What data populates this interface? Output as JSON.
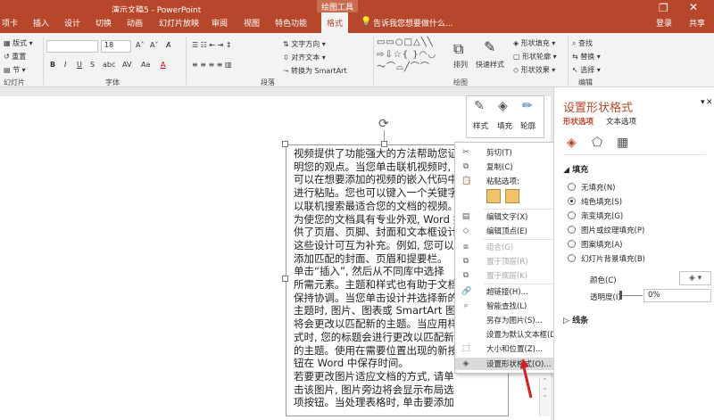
{
  "title": {
    "doc": "演示文稿5 - PowerPoint",
    "tools": "绘图工具"
  },
  "tabs": [
    "项卡",
    "插入",
    "设计",
    "切换",
    "动画",
    "幻灯片放映",
    "审阅",
    "视图",
    "特色功能",
    "格式"
  ],
  "tellme": "告诉我您想要做什么...",
  "user": {
    "login": "登录",
    "share": "共享"
  },
  "ribbon": {
    "layout": "版式",
    "reset": "重置",
    "section": "节",
    "slides_group": "幻灯片",
    "font_group": "字体",
    "para_group": "段落",
    "draw_group": "绘图",
    "edit_group": "编辑",
    "font_size": "18",
    "text_direction": "文字方向",
    "align_text": "对齐文本",
    "smartart": "转换为 SmartArt",
    "arrange": "排列",
    "quick_styles": "快速样式",
    "shape_fill": "形状填充",
    "shape_outline": "形状轮廓",
    "shape_effects": "形状效果",
    "find": "查找",
    "replace": "替换",
    "select": "选择"
  },
  "mini_toolbar": [
    "样式",
    "填充",
    "轮廓"
  ],
  "slide_text": [
    "视频提供了功能强大的方法帮助您证",
    "明您的观点。当您单击联机视频时,",
    "可以在想要添加的视频的嵌入代码中",
    "进行粘贴。您也可以键入一个关键字",
    "以联机搜索最适合您的文档的视频。",
    "为使您的文档具有专业外观, Word 提",
    "供了页眉、页脚、封面和文本框设计,",
    "这些设计可互为补充。例如, 您可以",
    "添加匹配的封面、页眉和提要栏。",
    "单击“插入”, 然后从不同库中选择",
    "所需元素。主题和样式也有助于文档",
    "保持协调。当您单击设计并选择新的",
    "主题时, 图片、图表或 SmartArt 图形",
    "将会更改以匹配新的主题。当应用样",
    "式时, 您的标题会进行更改以匹配新",
    "的主题。使用在需要位置出现的新按",
    "钮在 Word 中保存时间。",
    "若要更改图片适应文档的方式, 请单",
    "击该图片, 图片旁边将会显示布局选",
    "项按钮。当处理表格时, 单击要添加"
  ],
  "context_menu": {
    "cut": "剪切(T)",
    "copy": "复制(C)",
    "paste_options": "粘贴选项:",
    "edit_text": "编辑文字(X)",
    "edit_points": "编辑顶点(E)",
    "group": "组合(G)",
    "bring_front": "置于顶层(R)",
    "send_back": "置于底层(K)",
    "hyperlink": "超链接(H)...",
    "smart_lookup": "智能查找(L)",
    "save_picture": "另存为图片(S)...",
    "default_textbox": "设置为默认文本框(D)",
    "size_position": "大小和位置(Z)...",
    "format_shape": "设置形状格式(O)..."
  },
  "pane": {
    "title": "设置形状格式",
    "tab_shape": "形状选项",
    "tab_text": "文本选项",
    "fill_section": "填充",
    "options": [
      "无填充(N)",
      "纯色填充(S)",
      "渐变填充(G)",
      "图片或纹理填充(P)",
      "图案填充(A)",
      "幻灯片背景填充(B)"
    ],
    "selected_option": "纯色填充(S)",
    "color_label": "颜色(C)",
    "transparency_label": "透明度(I)",
    "transparency_value": "0%",
    "line_section": "线条"
  },
  "colors": {
    "accent": "#b7472a",
    "arrow": "#d21f1f"
  }
}
